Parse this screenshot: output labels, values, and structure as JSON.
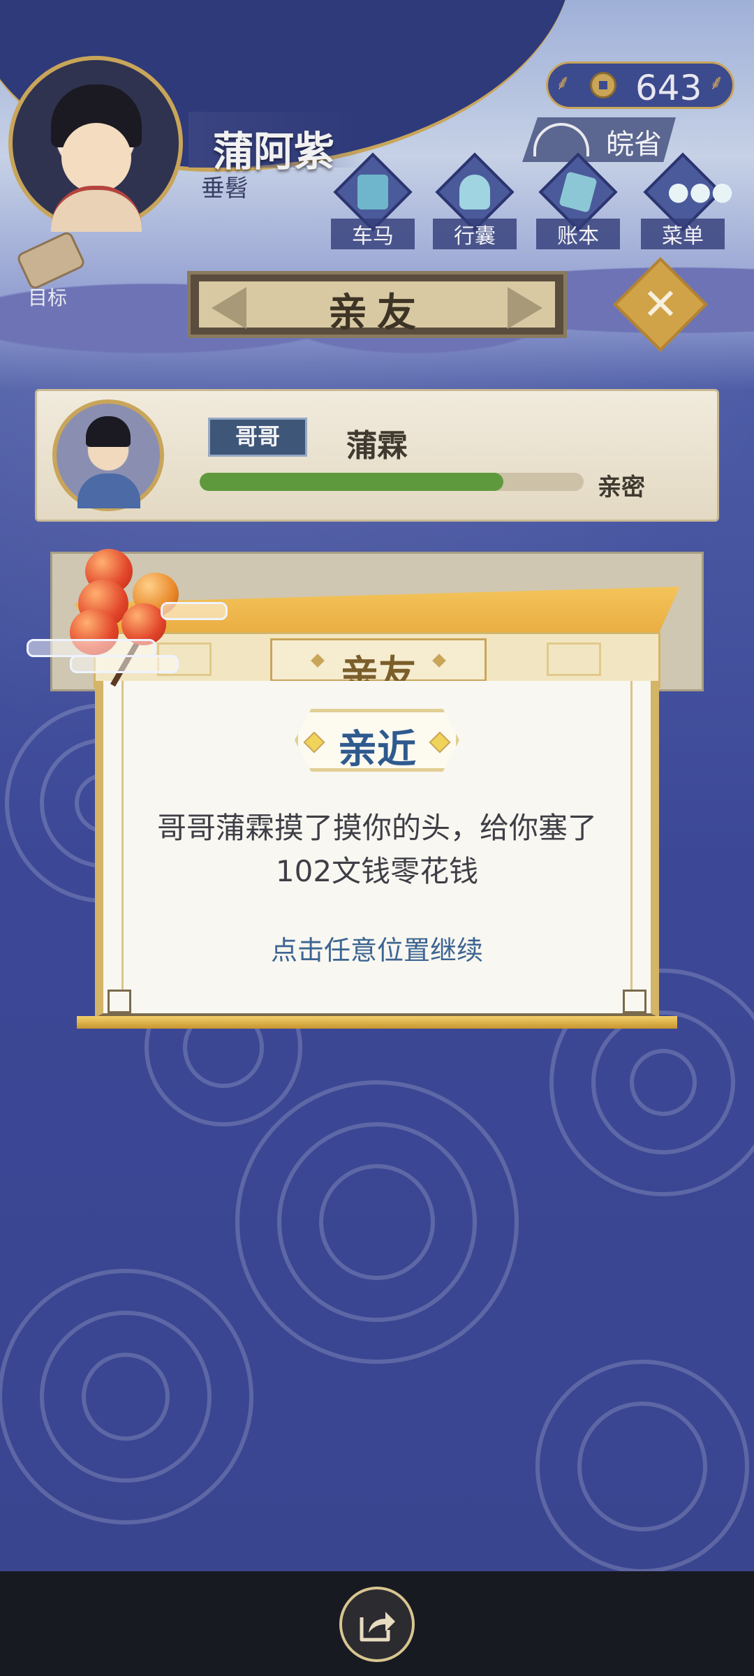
{
  "player": {
    "name": "蒲阿紫",
    "title": "垂髫"
  },
  "currency": {
    "value": "643"
  },
  "location": {
    "label": "皖省"
  },
  "nav": [
    {
      "label": "车马"
    },
    {
      "label": "行囊"
    },
    {
      "label": "账本"
    },
    {
      "label": "菜单"
    }
  ],
  "goal": {
    "label": "目标"
  },
  "section": {
    "title": "亲友"
  },
  "relative": {
    "relation": "哥哥",
    "name": "蒲霖",
    "affinity_label": "亲密",
    "affinity_fraction": 0.79
  },
  "dialog": {
    "heading": "亲友",
    "event_title": "亲近",
    "event_text": "哥哥蒲霖摸了摸你的头，给你塞了102文钱零花钱",
    "continue_hint": "点击任意位置继续"
  },
  "colors": {
    "accent_gold": "#c9a55a",
    "affinity_green": "#5e9a3d",
    "link_blue": "#3c6592"
  },
  "icons": {
    "share": "share-icon",
    "close": "close-icon",
    "coin": "coin-icon"
  }
}
